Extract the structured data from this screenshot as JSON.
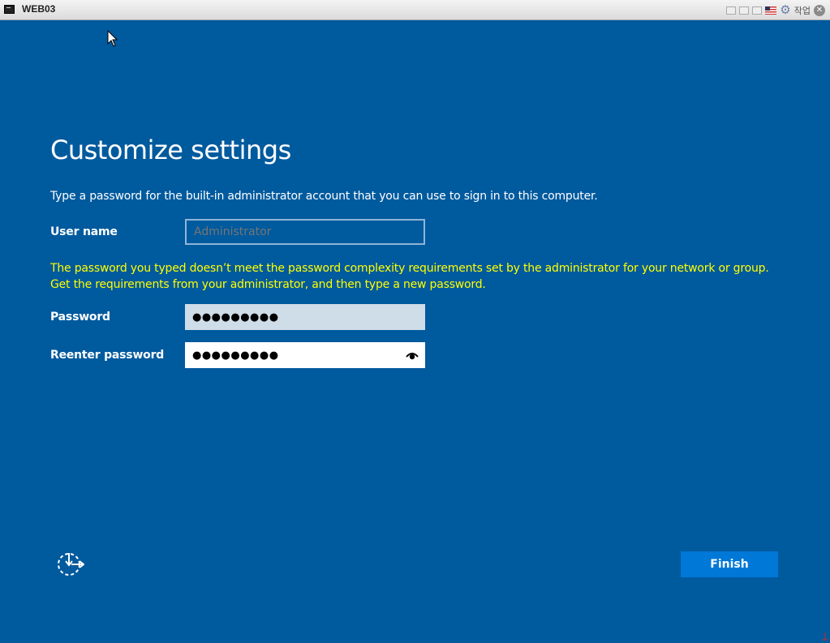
{
  "window": {
    "title": "WEB03",
    "controls_label": "작업"
  },
  "page": {
    "heading": "Customize settings",
    "instruction": "Type a password for the built-in administrator account that you can use to sign in to this computer.",
    "error_message": "The password you typed doesn’t meet the password complexity requirements set by the administrator for your network or group. Get the requirements from your administrator, and then type a new password."
  },
  "form": {
    "username_label": "User name",
    "username_placeholder": "Administrator",
    "password_label": "Password",
    "password_value": "●●●●●●●●●",
    "reenter_label": "Reenter password",
    "reenter_value": "●●●●●●●●●"
  },
  "footer": {
    "finish_label": "Finish"
  },
  "icons": {
    "window_icon": "console-window-icon",
    "accessibility": "ease-of-access-icon",
    "reveal_password": "eye-icon",
    "settings": "gear-icon",
    "close": "close-icon"
  },
  "colors": {
    "background": "#005a9e",
    "accent": "#0078d7",
    "error_text": "#ffff00"
  }
}
